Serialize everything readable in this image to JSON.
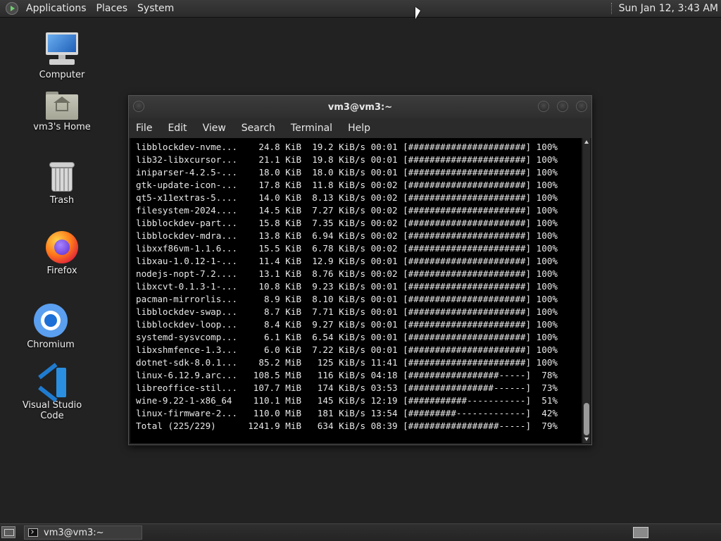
{
  "top_panel": {
    "menus": [
      "Applications",
      "Places",
      "System"
    ],
    "clock": "Sun Jan 12,  3:43 AM"
  },
  "desktop": {
    "icons": [
      {
        "label": "Computer",
        "icon": "computer-icon"
      },
      {
        "label": "vm3's Home",
        "icon": "home-folder-icon"
      },
      {
        "label": "Trash",
        "icon": "trash-icon"
      },
      {
        "label": "Firefox",
        "icon": "firefox-icon"
      },
      {
        "label": "Chromium",
        "icon": "chromium-icon"
      },
      {
        "label": "Visual Studio Code",
        "icon": "vscode-icon"
      }
    ]
  },
  "terminal": {
    "title": "vm3@vm3:~",
    "menu": [
      "File",
      "Edit",
      "View",
      "Search",
      "Terminal",
      "Help"
    ],
    "lines": [
      "libblockdev-nvme...    24.8 KiB  19.2 KiB/s 00:01 [######################] 100%",
      "lib32-libxcursor...    21.1 KiB  19.8 KiB/s 00:01 [######################] 100%",
      "iniparser-4.2.5-...    18.0 KiB  18.0 KiB/s 00:01 [######################] 100%",
      "gtk-update-icon-...    17.8 KiB  11.8 KiB/s 00:02 [######################] 100%",
      "qt5-x11extras-5....    14.0 KiB  8.13 KiB/s 00:02 [######################] 100%",
      "filesystem-2024....    14.5 KiB  7.27 KiB/s 00:02 [######################] 100%",
      "libblockdev-part...    15.8 KiB  7.35 KiB/s 00:02 [######################] 100%",
      "libblockdev-mdra...    13.8 KiB  6.94 KiB/s 00:02 [######################] 100%",
      "libxxf86vm-1.1.6...    15.5 KiB  6.78 KiB/s 00:02 [######################] 100%",
      "libxau-1.0.12-1-...    11.4 KiB  12.9 KiB/s 00:01 [######################] 100%",
      "nodejs-nopt-7.2....    13.1 KiB  8.76 KiB/s 00:02 [######################] 100%",
      "libxcvt-0.1.3-1-...    10.8 KiB  9.23 KiB/s 00:01 [######################] 100%",
      "pacman-mirrorlis...     8.9 KiB  8.10 KiB/s 00:01 [######################] 100%",
      "libblockdev-swap...     8.7 KiB  7.71 KiB/s 00:01 [######################] 100%",
      "libblockdev-loop...     8.4 KiB  9.27 KiB/s 00:01 [######################] 100%",
      "systemd-sysvcomp...     6.1 KiB  6.54 KiB/s 00:01 [######################] 100%",
      "libxshmfence-1.3...     6.0 KiB  7.22 KiB/s 00:01 [######################] 100%",
      "dotnet-sdk-8.0.1...    85.2 MiB   125 KiB/s 11:41 [######################] 100%",
      "linux-6.12.9.arc...   108.5 MiB   116 KiB/s 04:18 [#################-----]  78%",
      "libreoffice-stil...   107.7 MiB   174 KiB/s 03:53 [################------]  73%",
      "wine-9.22-1-x86_64    110.1 MiB   145 KiB/s 12:19 [###########-----------]  51%",
      "linux-firmware-2...   110.0 MiB   181 KiB/s 13:54 [#########-------------]  42%",
      "Total (225/229)      1241.9 MiB   634 KiB/s 08:39 [#################-----]  79%"
    ]
  },
  "taskbar": {
    "task_label": "vm3@vm3:~"
  }
}
